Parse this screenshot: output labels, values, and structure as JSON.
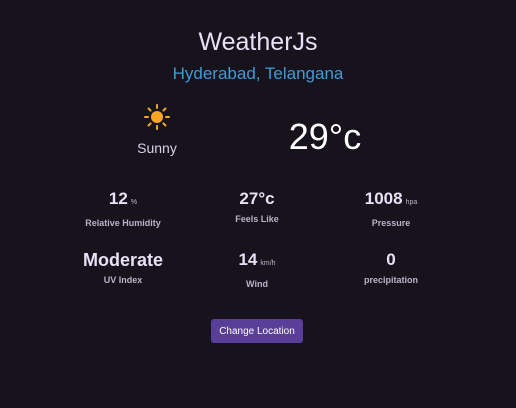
{
  "app": {
    "title": "WeatherJs"
  },
  "location": "Hyderabad, Telangana",
  "current": {
    "icon": "sun-icon",
    "condition": "Sunny",
    "temperature": "29°c"
  },
  "stats": {
    "humidity": {
      "value": "12",
      "unit": "%",
      "label": "Relative Humidity"
    },
    "feels_like": {
      "value": "27°c",
      "unit": "",
      "label": "Feels Like"
    },
    "pressure": {
      "value": "1008",
      "unit": "hpa",
      "label": "Pressure"
    },
    "uv": {
      "value": "Moderate",
      "unit": "",
      "label": "UV Index"
    },
    "wind": {
      "value": "14",
      "unit": "km/h",
      "label": "Wind"
    },
    "precipitation": {
      "value": "0",
      "unit": "",
      "label": "precipitation"
    }
  },
  "actions": {
    "change_location_label": "Change Location"
  },
  "colors": {
    "background": "#16131d",
    "location": "#3f9ad8",
    "sun": "#f5a623",
    "button": "#5a3f9a"
  }
}
